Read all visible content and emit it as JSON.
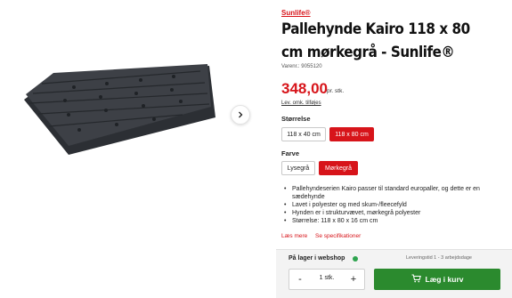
{
  "product": {
    "brand": "Sunlife®",
    "title": "Pallehynde Kairo 118 x 80 cm mørkegrå - Sunlife®",
    "sku": "Varenr.: 9055120",
    "price": "348,00",
    "price_unit": "pr. stk.",
    "shipping_link": "Lev. omk. tilføjes"
  },
  "gallery": {
    "cushion_color": "#3d4046",
    "next_icon": "chevron-right-icon"
  },
  "size": {
    "label": "Størrelse",
    "options": [
      {
        "label": "118 x 40 cm",
        "selected": false
      },
      {
        "label": "118 x 80 cm",
        "selected": true
      }
    ]
  },
  "color": {
    "label": "Farve",
    "options": [
      {
        "label": "Lysegrå",
        "selected": false
      },
      {
        "label": "Mørkegrå",
        "selected": true
      }
    ]
  },
  "bullets": [
    "Pallehyndeserien Kairo passer til standard europaller, og dette er en sædehynde",
    "Lavet i polyester og med skum-/fleecefyld",
    "Hynden er i strukturvævet, mørkegrå polyester",
    "Størrelse: 118 x 80 x 16 cm cm"
  ],
  "links": {
    "read_more": "Læs mere",
    "specs": "Se specifikationer"
  },
  "webshop": {
    "stock_label": "På lager i webshop",
    "delivery": "Leveringstid 1 - 3 arbejdsdage",
    "qty_minus": "-",
    "qty_value": "1 stk.",
    "qty_plus": "+",
    "cart_button": "Læg i kurv"
  },
  "colors": {
    "accent_red": "#d7141a",
    "cart_green": "#2b8a2e",
    "stock_green": "#2ea44f"
  }
}
